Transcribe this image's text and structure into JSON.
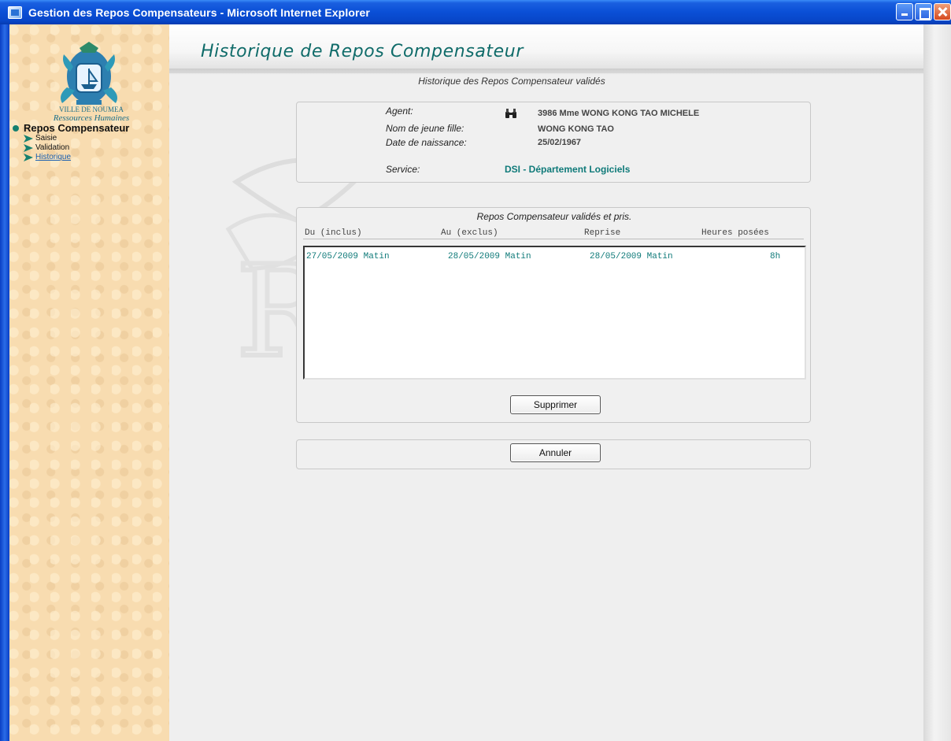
{
  "window": {
    "title": "Gestion des Repos Compensateurs - Microsoft Internet Explorer"
  },
  "sidebar": {
    "logo_line1": "VILLE DE NOUMEA",
    "logo_line2": "Ressources Humaines",
    "section": "Repos Compensateur",
    "items": [
      {
        "label": "Saisie"
      },
      {
        "label": "Validation"
      },
      {
        "label": "Historique"
      }
    ]
  },
  "header": {
    "title": "Historique de Repos Compensateur"
  },
  "main": {
    "subtitle": "Historique des Repos Compensateur validés",
    "agent": {
      "agent_label": "Agent:",
      "agent_value": "3986 Mme WONG KONG TAO MICHELE",
      "maiden_label": "Nom de jeune fille:",
      "maiden_value": "WONG KONG TAO",
      "birth_label": "Date de naissance:",
      "birth_value": "25/02/1967",
      "service_label": "Service:",
      "service_value": "DSI - Département Logiciels"
    },
    "list": {
      "title": "Repos Compensateur validés et pris.",
      "columns": [
        "Du (inclus)",
        "Au (exclus)",
        "Reprise",
        "Heures posées"
      ],
      "rows": [
        {
          "du": "27/05/2009 Matin",
          "au": "28/05/2009 Matin",
          "reprise": "28/05/2009 Matin",
          "heures": "8h"
        }
      ]
    },
    "buttons": {
      "delete": "Supprimer",
      "cancel": "Annuler"
    }
  },
  "colors": {
    "title_bar": "#0a4fd6",
    "sidebar_bg": "#f8dcb0",
    "accent_teal": "#0f7a79"
  },
  "icons": {
    "agent_search": "binoculars-icon",
    "nav_arrow": "arrow-right-icon"
  }
}
